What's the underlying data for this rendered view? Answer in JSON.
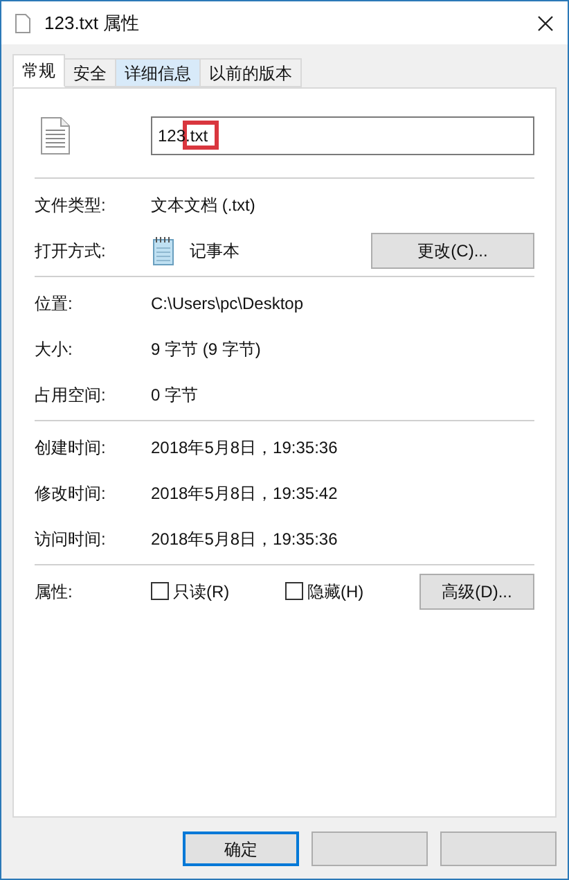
{
  "window": {
    "title": "123.txt 属性"
  },
  "tabs": [
    {
      "label": "常规",
      "selected": true,
      "hovered": false
    },
    {
      "label": "安全",
      "selected": false,
      "hovered": false
    },
    {
      "label": "详细信息",
      "selected": false,
      "hovered": true
    },
    {
      "label": "以前的版本",
      "selected": false,
      "hovered": false
    }
  ],
  "file_name": {
    "value": "123.txt"
  },
  "type_section": [
    {
      "label": "文件类型:",
      "value": "文本文档 (.txt)"
    },
    {
      "label": "打开方式:",
      "value": "记事本",
      "kind": "app",
      "button": "更改(C)..."
    }
  ],
  "location_section": [
    {
      "label": "位置:",
      "value": "C:\\Users\\pc\\Desktop"
    },
    {
      "label": "大小:",
      "value": "9 字节 (9 字节)"
    },
    {
      "label": "占用空间:",
      "value": "0 字节"
    }
  ],
  "time_section": [
    {
      "label": "创建时间:",
      "value": "2018年5月8日，19:35:36"
    },
    {
      "label": "修改时间:",
      "value": "2018年5月8日，19:35:42"
    },
    {
      "label": "访问时间:",
      "value": "2018年5月8日，19:35:36"
    }
  ],
  "attributes": {
    "label": "属性:",
    "checkboxes": [
      {
        "label": "只读(R)",
        "checked": false
      },
      {
        "label": "隐藏(H)",
        "checked": false
      }
    ],
    "button": "高级(D)..."
  },
  "buttons": [
    {
      "label": "确定",
      "default": true
    },
    {
      "default": false
    },
    {
      "default": false
    }
  ]
}
